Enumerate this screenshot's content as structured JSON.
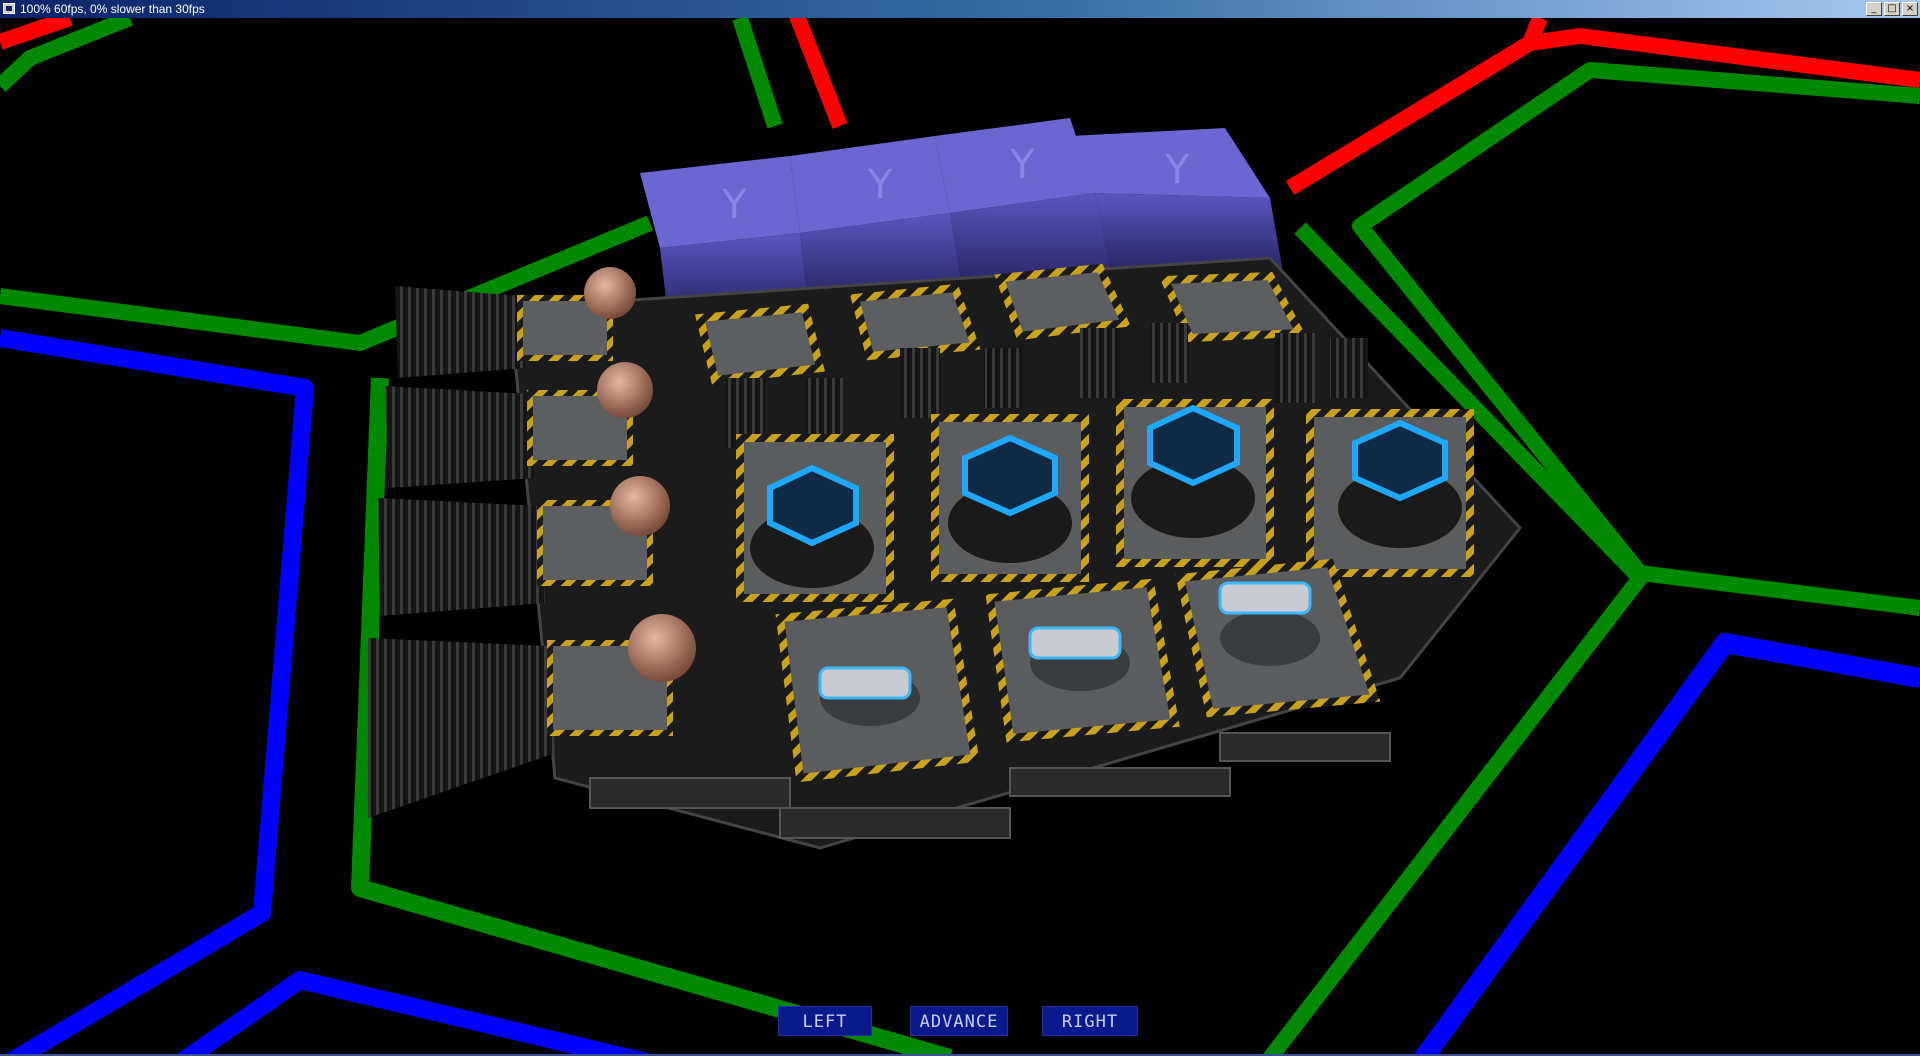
{
  "window": {
    "title": "100% 60fps, 0% slower than 30fps",
    "buttons": {
      "minimize": "_",
      "maximize": "□",
      "close": "×"
    }
  },
  "hud": {
    "left_label": "LEFT",
    "advance_label": "ADVANCE",
    "right_label": "RIGHT"
  },
  "scene": {
    "cube_glyph": "Y",
    "colors": {
      "grid_red": "#ff0000",
      "grid_green": "#008800",
      "grid_blue": "#0000ff",
      "cube": "#4a46a8",
      "hud_button": "#0a1a8c",
      "hazard_yellow": "#caa21a",
      "tank_glow": "#1ea8ff"
    }
  }
}
